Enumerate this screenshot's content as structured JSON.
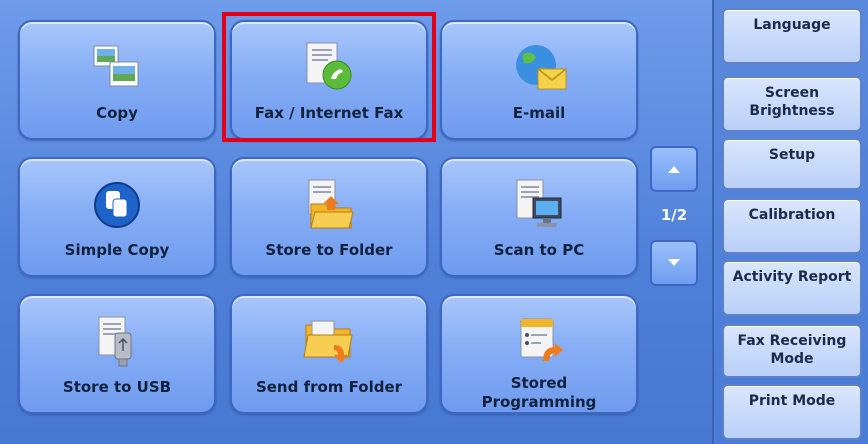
{
  "tiles": [
    {
      "label": "Copy",
      "icon": "copy-icon"
    },
    {
      "label": "Fax / Internet Fax",
      "icon": "fax-icon"
    },
    {
      "label": "E-mail",
      "icon": "email-icon"
    },
    {
      "label": "Simple Copy",
      "icon": "simple-copy-icon"
    },
    {
      "label": "Store to Folder",
      "icon": "store-folder-icon"
    },
    {
      "label": "Scan to PC",
      "icon": "scan-pc-icon"
    },
    {
      "label": "Store to USB",
      "icon": "usb-icon"
    },
    {
      "label": "Send from Folder",
      "icon": "send-folder-icon"
    },
    {
      "label": "Stored\nProgramming",
      "icon": "stored-programming-icon"
    }
  ],
  "pager": {
    "indicator": "1/2"
  },
  "side_buttons": [
    {
      "label": "Language"
    },
    {
      "label": "Screen\nBrightness"
    },
    {
      "label": "Setup"
    },
    {
      "label": "Calibration"
    },
    {
      "label": "Activity Report"
    },
    {
      "label": "Fax Receiving\nMode"
    },
    {
      "label": "Print Mode"
    }
  ],
  "colors": {
    "selection": "#e2001a",
    "background": "#4f80d8",
    "tile": "#86aef5"
  }
}
